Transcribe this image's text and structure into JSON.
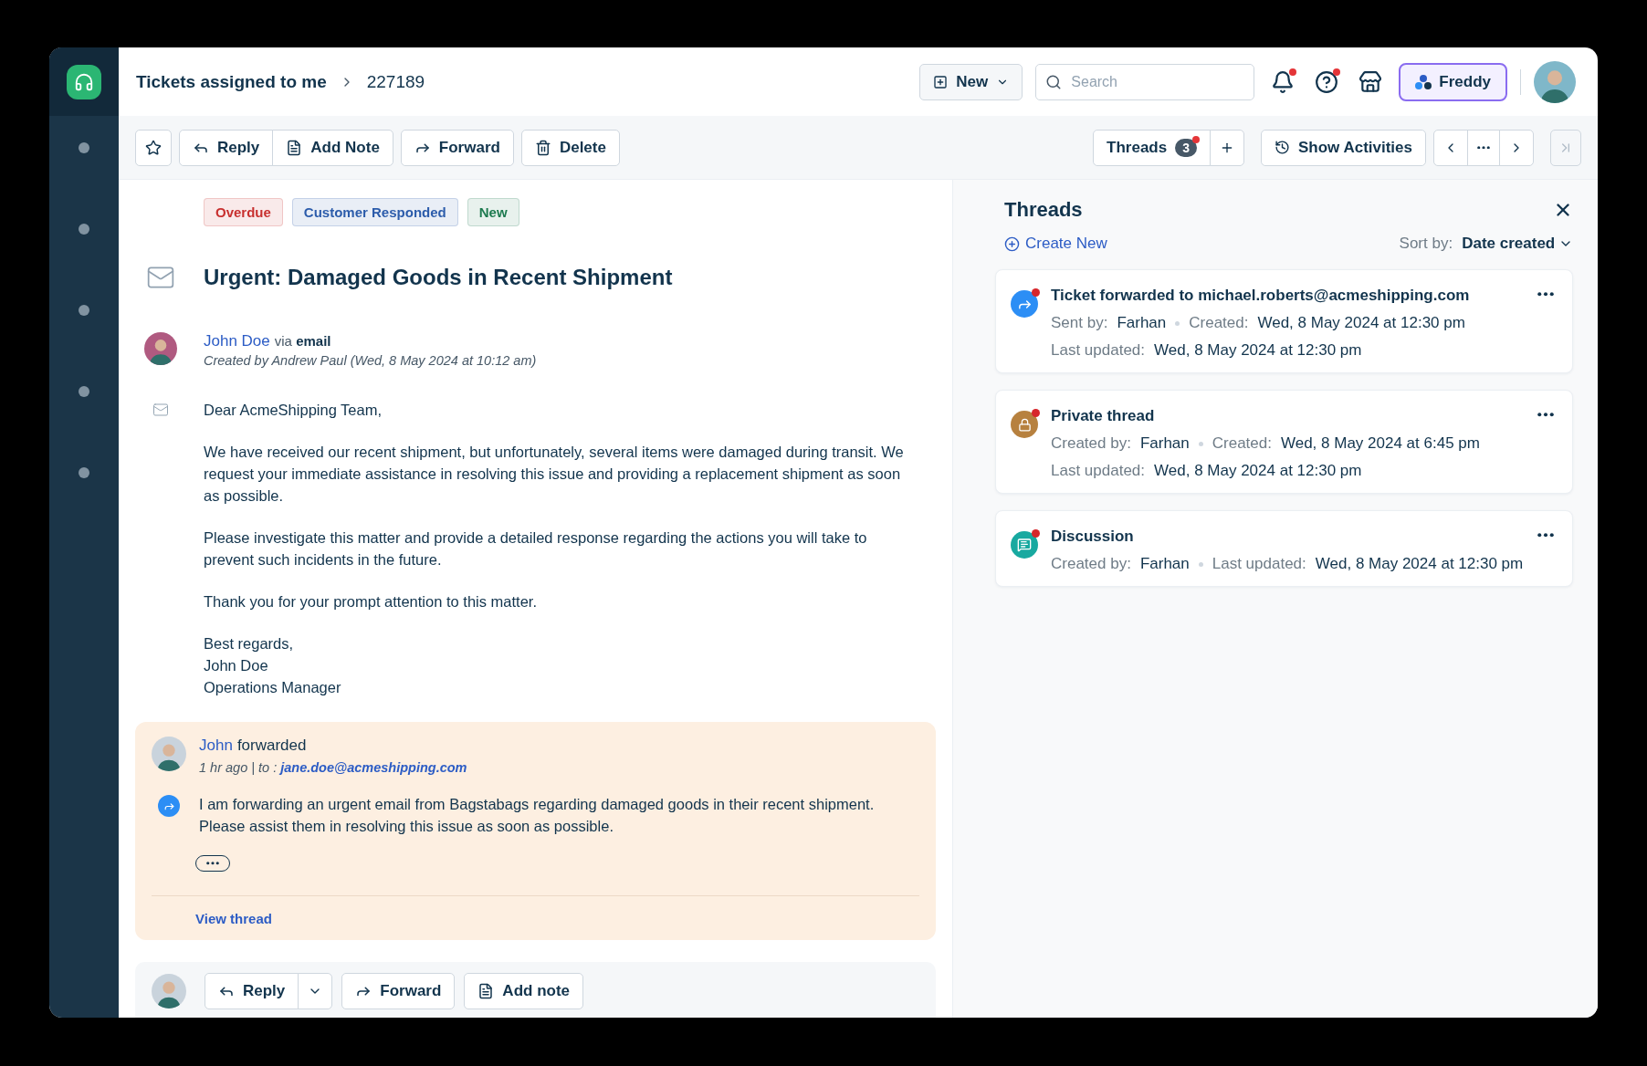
{
  "breadcrumb": {
    "parent": "Tickets assigned to me",
    "current": "227189"
  },
  "header": {
    "new_button": "New",
    "search": {
      "placeholder": "Search"
    },
    "notifications": {
      "alert": true
    },
    "help": {
      "alert": true
    },
    "assistant": "Freddy"
  },
  "toolbar": {
    "buttons": [
      {
        "kind": "star"
      },
      {
        "kind": "reply",
        "label": "Reply"
      },
      {
        "kind": "note",
        "label": "Add Note"
      },
      {
        "kind": "forward",
        "label": "Forward"
      },
      {
        "kind": "delete",
        "label": "Delete"
      }
    ],
    "threads": {
      "label": "Threads",
      "count": "3",
      "alert": true
    },
    "show_activities": "Show Activities"
  },
  "ticket": {
    "tags": [
      {
        "label": "Overdue",
        "color": "#c8302f"
      },
      {
        "label": "Customer Responded",
        "color": "#2c5cab"
      },
      {
        "label": "New",
        "color": "#1d7a4f"
      }
    ],
    "title": "Urgent: Damaged Goods in Recent Shipment",
    "sender": {
      "name": "John Doe",
      "via": "via **email**",
      "created": "Created by Andrew Paul (Wed, 8 May 2024 at 10:12 am)"
    },
    "greeting": "Dear AcmeShipping Team,",
    "paragraphs": [
      "We have received our recent shipment, but unfortunately, several items were damaged during transit. We request your immediate assistance in resolving this issue and providing a replacement shipment as soon as possible.",
      "Please investigate this matter and provide a detailed response regarding the actions you will take to prevent such incidents in the future.",
      "Thank you for your prompt attention to this matter."
    ],
    "signature": [
      "Best regards,",
      "John Doe",
      "Operations Manager"
    ]
  },
  "forward_note": {
    "author": "John",
    "action": "forwarded",
    "meta": "1 hr ago | to :",
    "email": "jane.doe@acmeshipping.com",
    "body": "I am forwarding an urgent email from Bagstabags regarding damaged goods in their recent shipment. Please assist them in resolving this issue as soon as possible.",
    "view_thread": "View thread"
  },
  "reply_bar": {
    "buttons": [
      {
        "kind": "reply",
        "label": "Reply"
      },
      {
        "kind": "forward",
        "label": "Forward"
      },
      {
        "kind": "note",
        "label": "Add note"
      }
    ]
  },
  "threads_panel": {
    "title": "Threads",
    "create_new": "Create New",
    "sort_label": "Sort by:",
    "sort_value": "Date created",
    "items": [
      {
        "kind": "forward",
        "unread": true,
        "title": "Ticket forwarded to michael.roberts@acmeshipping.com",
        "lines": [
          [
            {
              "label": "Sent by:",
              "value": "Farhan"
            },
            {
              "label": "Created:",
              "value": "Wed, 8 May 2024 at 12:30 pm"
            }
          ],
          [
            {
              "label": "Last updated:",
              "value": "Wed, 8 May 2024 at 12:30 pm"
            }
          ]
        ]
      },
      {
        "kind": "private",
        "unread": true,
        "title": "Private thread",
        "lines": [
          [
            {
              "label": "Created by:",
              "value": "Farhan"
            },
            {
              "label": "Created:",
              "value": "Wed, 8 May 2024 at 6:45 pm"
            }
          ],
          [
            {
              "label": "Last updated:",
              "value": "Wed, 8 May 2024 at 12:30 pm"
            }
          ]
        ]
      },
      {
        "kind": "discussion",
        "unread": true,
        "title": "Discussion",
        "lines": [
          [
            {
              "label": "Created by:",
              "value": "Farhan"
            },
            {
              "label": "Last updated:",
              "value": "Wed, 8 May 2024 at 12:30 pm"
            }
          ]
        ]
      }
    ]
  }
}
